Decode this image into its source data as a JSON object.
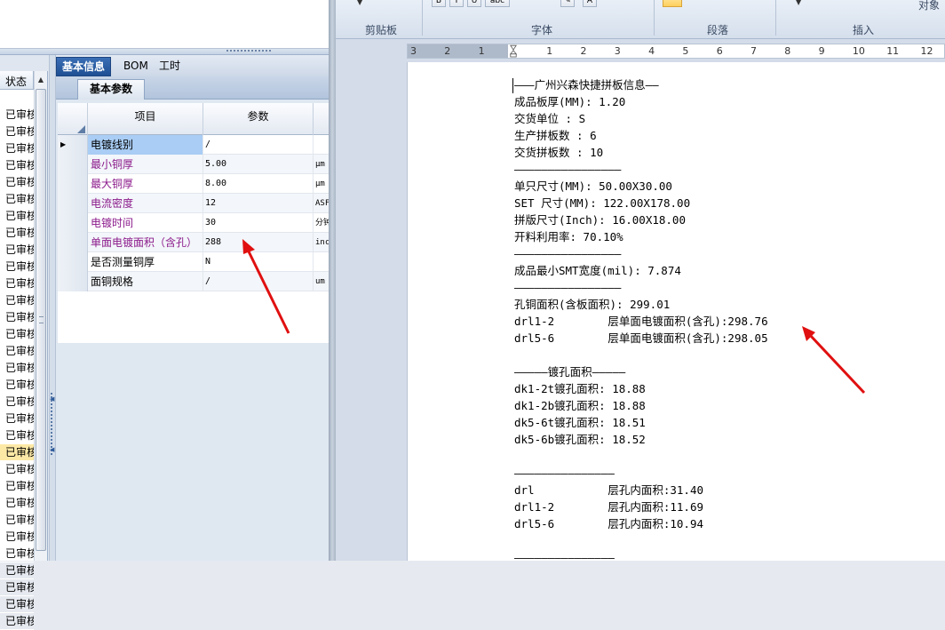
{
  "left_app": {
    "status_header": "状态",
    "status_rows": [
      "已审核",
      "已审核",
      "已审核",
      "已审核",
      "已审核",
      "已审核",
      "已审核",
      "已审核",
      "已审核",
      "已审核",
      "已审核",
      "已审核",
      "已审核",
      "已审核",
      "已审核",
      "已审核",
      "已审核",
      "已审核",
      "已审核",
      "已审核",
      "已审核",
      "已审核",
      "已审核",
      "已审核",
      "已审核",
      "已审核",
      "已审核",
      "已审核",
      "已审核",
      "已审核",
      "已审核"
    ],
    "selected_row_index": 20,
    "tabs": [
      "基本信息",
      "BOM",
      "工时"
    ],
    "sub_tab": "基本参数",
    "grid": {
      "headers": [
        "项目",
        "参数",
        ""
      ],
      "rows": [
        {
          "item": "电镀线别",
          "param": "/",
          "unit": "",
          "style": "hl",
          "current": true
        },
        {
          "item": "最小铜厚",
          "param": "5.00",
          "unit": "μm",
          "style": "purple"
        },
        {
          "item": "最大铜厚",
          "param": "8.00",
          "unit": "μm",
          "style": "purple"
        },
        {
          "item": "电流密度",
          "param": "12",
          "unit": "ASF",
          "style": "purple"
        },
        {
          "item": "电镀时间",
          "param": "30",
          "unit": "分钟",
          "style": "purple"
        },
        {
          "item": "单面电镀面积（含孔）",
          "param": "288",
          "unit": "inch",
          "style": "purple"
        },
        {
          "item": "是否测量铜厚",
          "param": "N",
          "unit": "",
          "style": ""
        },
        {
          "item": "面铜规格",
          "param": "/",
          "unit": "um",
          "style": ""
        }
      ]
    }
  },
  "word": {
    "ribbon_groups": [
      "剪贴板",
      "字体",
      "段落",
      "插入",
      "对象"
    ],
    "ruler_numbers": [
      "3",
      "2",
      "1",
      "",
      "1",
      "2",
      "3",
      "4",
      "5",
      "6",
      "7",
      "8",
      "9",
      "10",
      "11",
      "12"
    ],
    "document_lines": [
      "———广州兴森快捷拼板信息——",
      "成品板厚(MM): 1.20",
      "交货单位 : S",
      "生产拼板数 : 6",
      "交货拼板数 : 10",
      "————————————————",
      "单只尺寸(MM): 50.00X30.00",
      "SET 尺寸(MM): 122.00X178.00",
      "拼版尺寸(Inch): 16.00X18.00",
      "开料利用率: 70.10%",
      "————————————————",
      "成品最小SMT宽度(mil): 7.874",
      "————————————————",
      "孔铜面积(含板面积): 299.01",
      "drl1-2        层单面电镀面积(含孔):298.76",
      "drl5-6        层单面电镀面积(含孔):298.05",
      "",
      "—————镀孔面积—————",
      "dk1-2t镀孔面积: 18.88",
      "dk1-2b镀孔面积: 18.88",
      "dk5-6t镀孔面积: 18.51",
      "dk5-6b镀孔面积: 18.52",
      "",
      "———————————————",
      "drl           层孔内面积:31.40",
      "drl1-2        层孔内面积:11.69",
      "drl5-6        层孔内面积:10.94",
      "",
      "———————————————"
    ]
  },
  "colors": {
    "annotation_arrow": "#e01010",
    "tab_active": "#1e4f94",
    "purple_text": "#8b1a8b",
    "highlight": "#a9cdf4",
    "selected_row": "#fde9a6"
  }
}
